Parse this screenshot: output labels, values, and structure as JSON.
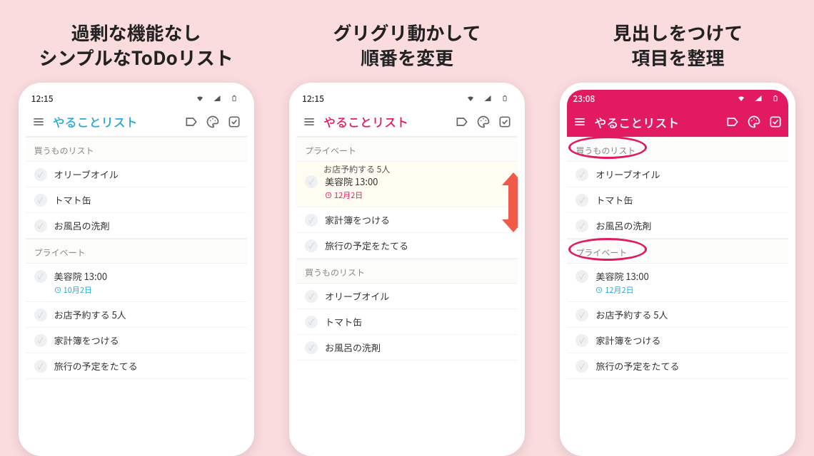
{
  "cols": [
    {
      "tagline": "過剰な機能なし\nシンプルなToDoリスト",
      "phone": {
        "theme": "white",
        "status_time": "12:15",
        "accent": "#2aa7d4",
        "app_title": "やることリスト",
        "sections": [
          {
            "header": "買うものリスト",
            "items": [
              {
                "text": "オリーブオイル"
              },
              {
                "text": "トマト缶"
              },
              {
                "text": "お風呂の洗剤"
              }
            ]
          },
          {
            "header": "プライベート",
            "items": [
              {
                "text": "美容院 13:00",
                "sub": "10月2日",
                "sub_color": "blue"
              },
              {
                "text": "お店予約する 5人"
              },
              {
                "text": "家計簿をつける"
              },
              {
                "text": "旅行の予定をたてる"
              }
            ]
          }
        ]
      }
    },
    {
      "tagline": "グリグリ動かして\n順番を変更",
      "phone": {
        "theme": "white",
        "status_time": "12:15",
        "accent": "#e21a5f",
        "app_title": "やることリスト",
        "drag_arrow": true,
        "sections": [
          {
            "header": "プライベート",
            "items": [
              {
                "text": "美容院 13:00",
                "sub": "12月2日",
                "sub_color": "pink",
                "highlight": true,
                "stacked_over": "お店予約する 5人"
              },
              {
                "text": "家計簿をつける"
              },
              {
                "text": "旅行の予定をたてる"
              }
            ]
          },
          {
            "header": "買うものリスト",
            "items": [
              {
                "text": "オリーブオイル"
              },
              {
                "text": "トマト缶"
              },
              {
                "text": "お風呂の洗剤"
              }
            ]
          }
        ]
      }
    },
    {
      "tagline": "見出しをつけて\n項目を整理",
      "phone": {
        "theme": "pink",
        "status_time": "23:08",
        "accent": "#e21a5f",
        "app_title": "やることリスト",
        "circles": [
          0,
          1
        ],
        "sections": [
          {
            "header": "買うものリスト",
            "items": [
              {
                "text": "オリーブオイル"
              },
              {
                "text": "トマト缶"
              },
              {
                "text": "お風呂の洗剤"
              }
            ]
          },
          {
            "header": "プライベート",
            "items": [
              {
                "text": "美容院 13:00",
                "sub": "12月2日",
                "sub_color": "blue"
              },
              {
                "text": "お店予約する 5人"
              },
              {
                "text": "家計簿をつける"
              },
              {
                "text": "旅行の予定をたてる"
              }
            ]
          }
        ]
      }
    }
  ],
  "icons": {
    "label": "label-icon",
    "palette": "palette-icon",
    "check": "checkbox-icon",
    "menu": "menu-icon",
    "clock": "clock-icon",
    "wifi": "wifi-icon",
    "cell": "cell-icon",
    "batt": "battery-icon"
  }
}
